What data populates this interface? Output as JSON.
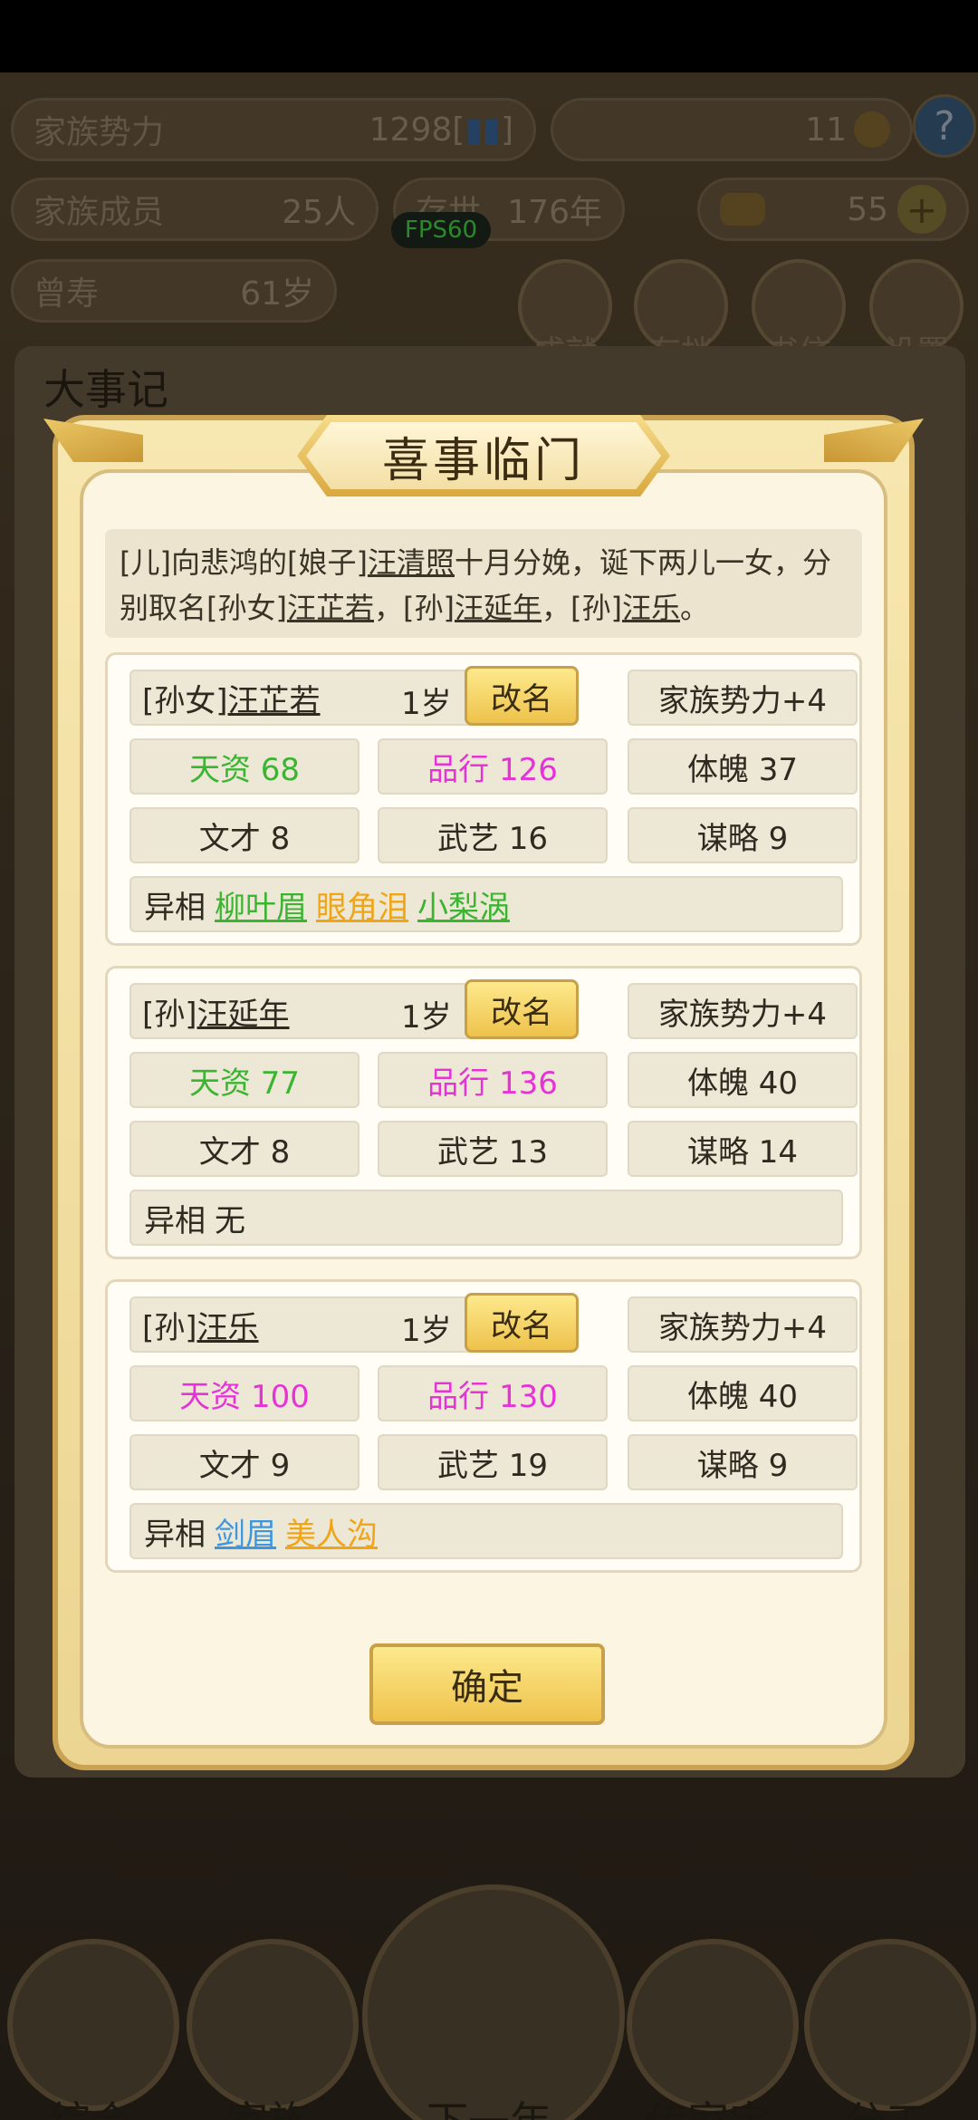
{
  "hud": {
    "clan_power_label": "家族势力",
    "clan_power_value": "1298[",
    "clan_power_value_end": "]",
    "coins_value": "11",
    "members_label": "家族成员",
    "members_value": "25人",
    "lived_label": "存世",
    "lived_value": "176年",
    "gold_value": "55",
    "longevity_label": "曾寿",
    "longevity_value": "61岁",
    "fps": "FPS60",
    "menu": [
      "成就",
      "存档",
      "书信",
      "设置"
    ]
  },
  "background": {
    "panel_title": "大事记"
  },
  "dialog": {
    "title": "喜事临门",
    "event_text": {
      "p1": "[儿]向悲鸿的[娘子]",
      "p2": "汪清照",
      "p3": "十月分娩，诞下两儿一女，分别取名[孙女]",
      "p4": "汪芷若",
      "p5": "，[孙]",
      "p6": "汪延年",
      "p7": "，[孙]",
      "p8": "汪乐",
      "p9": "。"
    },
    "children": [
      {
        "title": "[孙女]",
        "name": "汪芷若",
        "age": "1岁",
        "rename": "改名",
        "power": "家族势力+4",
        "talent": "天资 68",
        "morality": "品行 126",
        "physique": "体魄 37",
        "literary": "文才 8",
        "martial": "武艺 16",
        "strategy": "谋略 9",
        "traits_label": "异相",
        "traits": [
          "柳叶眉",
          "眼角泪",
          "小梨涡"
        ]
      },
      {
        "title": "[孙]",
        "name": "汪延年",
        "age": "1岁",
        "rename": "改名",
        "power": "家族势力+4",
        "talent": "天资 77",
        "morality": "品行 136",
        "physique": "体魄 40",
        "literary": "文才 8",
        "martial": "武艺 13",
        "strategy": "谋略 14",
        "traits_label": "异相",
        "traits_none": "无"
      },
      {
        "title": "[孙]",
        "name": "汪乐",
        "age": "1岁",
        "rename": "改名",
        "power": "家族势力+4",
        "talent": "天资 100",
        "morality": "品行 130",
        "physique": "体魄 40",
        "literary": "文才 9",
        "martial": "武艺 19",
        "strategy": "谋略 9",
        "traits_label": "异相",
        "traits": [
          "剑眉",
          "美人沟"
        ]
      }
    ],
    "confirm": "确定"
  },
  "bottom_nav": [
    "综合",
    "家族",
    "下一年",
    "传家宝",
    "分工"
  ],
  "colors": {
    "talent_green": "#3bb531",
    "magenta": "#e633d6",
    "orange": "#f0a516",
    "blue": "#3d97e0",
    "gold_button": "#eec24b"
  }
}
